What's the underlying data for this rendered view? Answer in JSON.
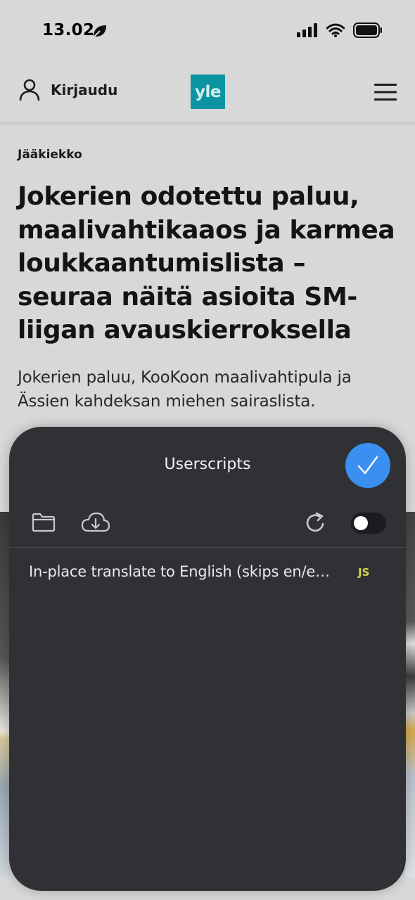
{
  "status_bar": {
    "time": "13.02"
  },
  "header": {
    "login_label": "Kirjaudu",
    "logo_text": "yle",
    "brand_color": "#0b95a3"
  },
  "article": {
    "category": "Jääkiekko",
    "headline": "Jokerien odotettu paluu, maalivahtikaaos ja karmea loukkaantumislista – seuraa näitä asioita SM-liigan avaus­kierroksella",
    "lead": "Jokerien paluu, KooKoon maalivahtipula ja Ässien kahdeksan miehen sairaslista."
  },
  "userscripts_panel": {
    "title": "Userscripts",
    "accent_color": "#3a8ff0",
    "toggle_on": false,
    "scripts": [
      {
        "name": "In-place translate to English (skips en/eng pages)",
        "type": "JS"
      }
    ]
  },
  "icons": {
    "login": "person-icon",
    "menu": "hamburger-icon",
    "done": "checkmark-icon",
    "folder": "folder-icon",
    "download": "cloud-download-icon",
    "refresh": "refresh-icon"
  }
}
